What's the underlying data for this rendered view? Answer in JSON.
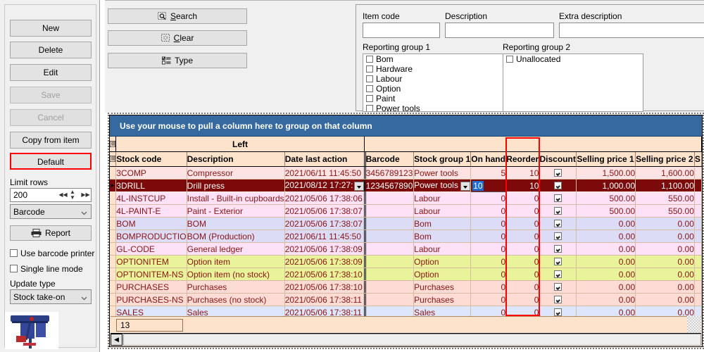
{
  "sidebar": {
    "buttons": [
      {
        "label": "New",
        "state": "enabled"
      },
      {
        "label": "Delete",
        "state": "enabled"
      },
      {
        "label": "Edit",
        "state": "enabled"
      },
      {
        "label": "Save",
        "state": "disabled"
      },
      {
        "label": "Cancel",
        "state": "disabled"
      },
      {
        "label": "Copy from item",
        "state": "enabled"
      },
      {
        "label": "Default",
        "state": "highlighted"
      }
    ],
    "limit_rows_label": "Limit rows",
    "limit_rows_value": "200",
    "sort_combo_value": "Barcode",
    "report_label": "Report",
    "use_barcode_printer": "Use barcode printer",
    "single_line_mode": "Single line mode",
    "update_type_label": "Update type",
    "update_type_value": "Stock take-on"
  },
  "toolbar": {
    "search_label": "Search",
    "clear_label": "Clear",
    "type_label": "Type"
  },
  "form": {
    "item_code_label": "Item code",
    "item_code_value": "",
    "description_label": "Description",
    "description_value": "",
    "extra_description_label": "Extra description",
    "extra_description_value": "",
    "reporting_group_1_label": "Reporting group 1",
    "reporting_group_1_items": [
      "Bom",
      "Hardware",
      "Labour",
      "Option",
      "Paint",
      "Power tools"
    ],
    "reporting_group_2_label": "Reporting group 2",
    "reporting_group_2_items": [
      "Unallocated"
    ]
  },
  "grid": {
    "group_bar_text": "Use your mouse to pull a column here to group on that column",
    "band_label": "Left",
    "columns": [
      "Stock code",
      "Description",
      "Date last action",
      "Barcode",
      "Stock group 1",
      "On hand",
      "Reorder",
      "Discount",
      "Selling price 1",
      "Selling price 2",
      "S"
    ],
    "footer_count": "13",
    "editing_cell": {
      "column": "On hand",
      "value": "10",
      "selected": true
    },
    "rows": [
      {
        "stock_code": "3COMP",
        "description": "Compressor",
        "date_last_action": "2021/06/11 11:45:50",
        "barcode": "3456789123",
        "stock_group_1": "Power tools",
        "on_hand": "5",
        "reorder": "10",
        "discount": true,
        "selling_price_1": "1,500.00",
        "selling_price_2": "1,600.00",
        "color": "#fde3e3",
        "selected": false
      },
      {
        "stock_code": "3DRILL",
        "description": "Drill press",
        "date_last_action": "2021/08/12 17:27:",
        "barcode": "1234567890",
        "stock_group_1": "Power tools",
        "on_hand": "10",
        "reorder": "10",
        "discount": true,
        "selling_price_1": "1,000.00",
        "selling_price_2": "1,100.00",
        "color": "#7c0a0a",
        "selected": true
      },
      {
        "stock_code": "4L-INSTCUP",
        "description": "Install - Built-in cupboards",
        "date_last_action": "2021/05/06 17:38:06",
        "barcode": "",
        "stock_group_1": "Labour",
        "on_hand": "0",
        "reorder": "0",
        "discount": true,
        "selling_price_1": "500.00",
        "selling_price_2": "550.00",
        "color": "#fde1f6",
        "selected": false
      },
      {
        "stock_code": "4L-PAINT-E",
        "description": "Paint - Exterior",
        "date_last_action": "2021/05/06 17:38:07",
        "barcode": "",
        "stock_group_1": "Labour",
        "on_hand": "0",
        "reorder": "0",
        "discount": true,
        "selling_price_1": "500.00",
        "selling_price_2": "550.00",
        "color": "#fde1f6",
        "selected": false
      },
      {
        "stock_code": "BOM",
        "description": "BOM",
        "date_last_action": "2021/05/06 17:38:07",
        "barcode": "",
        "stock_group_1": "Bom",
        "on_hand": "0",
        "reorder": "0",
        "discount": true,
        "selling_price_1": "0.00",
        "selling_price_2": "0.00",
        "color": "#dcdcf7",
        "selected": false
      },
      {
        "stock_code": "BOMPRODUCTIO",
        "description": "BOM (Production)",
        "date_last_action": "2021/06/11 11:45:50",
        "barcode": "",
        "stock_group_1": "Bom",
        "on_hand": "0",
        "reorder": "0",
        "discount": true,
        "selling_price_1": "0.00",
        "selling_price_2": "0.00",
        "color": "#dcdcf7",
        "selected": false
      },
      {
        "stock_code": "GL-CODE",
        "description": "General ledger",
        "date_last_action": "2021/05/06 17:38:09",
        "barcode": "",
        "stock_group_1": "Labour",
        "on_hand": "0",
        "reorder": "0",
        "discount": true,
        "selling_price_1": "0.00",
        "selling_price_2": "0.00",
        "color": "#fde1f6",
        "selected": false
      },
      {
        "stock_code": "OPTIONITEM",
        "description": "Option item",
        "date_last_action": "2021/05/06 17:38:09",
        "barcode": "",
        "stock_group_1": "Option",
        "on_hand": "0",
        "reorder": "0",
        "discount": true,
        "selling_price_1": "0.00",
        "selling_price_2": "0.00",
        "color": "#e8f39a",
        "selected": false
      },
      {
        "stock_code": "OPTIONITEM-NS",
        "description": "Option item (no stock)",
        "date_last_action": "2021/05/06 17:38:10",
        "barcode": "",
        "stock_group_1": "Option",
        "on_hand": "0",
        "reorder": "0",
        "discount": true,
        "selling_price_1": "0.00",
        "selling_price_2": "0.00",
        "color": "#e8f39a",
        "selected": false
      },
      {
        "stock_code": "PURCHASES",
        "description": "Purchases",
        "date_last_action": "2021/05/06 17:38:10",
        "barcode": "",
        "stock_group_1": "Purchases",
        "on_hand": "0",
        "reorder": "0",
        "discount": true,
        "selling_price_1": "0.00",
        "selling_price_2": "0.00",
        "color": "#fcdcd4",
        "selected": false
      },
      {
        "stock_code": "PURCHASES-NS",
        "description": "Purchases (no stock)",
        "date_last_action": "2021/05/06 17:38:11",
        "barcode": "",
        "stock_group_1": "Purchases",
        "on_hand": "0",
        "reorder": "0",
        "discount": true,
        "selling_price_1": "0.00",
        "selling_price_2": "0.00",
        "color": "#fcdcd4",
        "selected": false
      },
      {
        "stock_code": "SALES",
        "description": "Sales",
        "date_last_action": "2021/05/06 17:38:11",
        "barcode": "",
        "stock_group_1": "Sales",
        "on_hand": "0",
        "reorder": "0",
        "discount": true,
        "selling_price_1": "0.00",
        "selling_price_2": "0.00",
        "color": "#dde6fa",
        "selected": false
      }
    ]
  },
  "colors": {
    "accent_blue": "#35699f",
    "selected_row": "#7c0a0a",
    "grid_header": "#fde3cc",
    "annotation_red": "#ff0000",
    "text_red": "#8b1313"
  }
}
